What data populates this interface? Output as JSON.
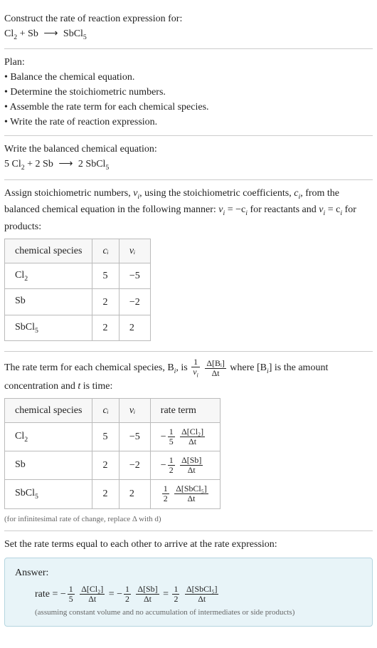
{
  "prompt": {
    "intro": "Construct the rate of reaction expression for:",
    "equation_lhs1": "Cl",
    "equation_lhs1_sub": "2",
    "equation_plus1": " + Sb ",
    "equation_arrow": "⟶",
    "equation_rhs": " SbCl",
    "equation_rhs_sub": "5"
  },
  "plan": {
    "title": "Plan:",
    "items": [
      "Balance the chemical equation.",
      "Determine the stoichiometric numbers.",
      "Assemble the rate term for each chemical species.",
      "Write the rate of reaction expression."
    ]
  },
  "balanced": {
    "intro": "Write the balanced chemical equation:",
    "c1": "5 Cl",
    "c1_sub": "2",
    "plus": " + 2 Sb ",
    "arrow": "⟶",
    "rhs": " 2 SbCl",
    "rhs_sub": "5"
  },
  "stoich_intro": {
    "part1": "Assign stoichiometric numbers, ",
    "nu": "ν",
    "nui_sub": "i",
    "part2": ", using the stoichiometric coefficients, ",
    "c": "c",
    "ci_sub": "i",
    "part3": ", from the balanced chemical equation in the following manner: ",
    "rel1a": "ν",
    "rel1b": "i",
    "rel1c": " = −c",
    "rel1d": "i",
    "part4": " for reactants and ",
    "rel2a": "ν",
    "rel2b": "i",
    "rel2c": " = c",
    "rel2d": "i",
    "part5": " for products:"
  },
  "table1": {
    "headers": [
      "chemical species",
      "cᵢ",
      "νᵢ"
    ],
    "rows": [
      {
        "name": "Cl",
        "sub": "2",
        "ci": "5",
        "vi": "−5"
      },
      {
        "name": "Sb",
        "sub": "",
        "ci": "2",
        "vi": "−2"
      },
      {
        "name": "SbCl",
        "sub": "5",
        "ci": "2",
        "vi": "2"
      }
    ]
  },
  "rate_intro": {
    "part1": "The rate term for each chemical species, B",
    "bi_sub": "i",
    "part2": ", is ",
    "f1_num": "1",
    "f1_den_a": "ν",
    "f1_den_b": "i",
    "f2_num": "Δ[Bᵢ]",
    "f2_den": "Δt",
    "part3": " where [B",
    "bi2_sub": "i",
    "part4": "] is the amount concentration and ",
    "t": "t",
    "part5": " is time:"
  },
  "table2": {
    "headers": [
      "chemical species",
      "cᵢ",
      "νᵢ",
      "rate term"
    ],
    "rows": [
      {
        "name": "Cl",
        "sub": "2",
        "ci": "5",
        "vi": "−5",
        "sign": "−",
        "fnum": "1",
        "fden": "5",
        "dnum": "Δ[Cl₂]",
        "dden": "Δt"
      },
      {
        "name": "Sb",
        "sub": "",
        "ci": "2",
        "vi": "−2",
        "sign": "−",
        "fnum": "1",
        "fden": "2",
        "dnum": "Δ[Sb]",
        "dden": "Δt"
      },
      {
        "name": "SbCl",
        "sub": "5",
        "ci": "2",
        "vi": "2",
        "sign": "",
        "fnum": "1",
        "fden": "2",
        "dnum": "Δ[SbCl₅]",
        "dden": "Δt"
      }
    ]
  },
  "note1": "(for infinitesimal rate of change, replace Δ with d)",
  "final_intro": "Set the rate terms equal to each other to arrive at the rate expression:",
  "answer": {
    "label": "Answer:",
    "rate_eq": "rate = ",
    "s1_sign": "−",
    "s1_fnum": "1",
    "s1_fden": "5",
    "s1_dnum": "Δ[Cl₂]",
    "s1_dden": "Δt",
    "eq1": " = ",
    "s2_sign": "−",
    "s2_fnum": "1",
    "s2_fden": "2",
    "s2_dnum": "Δ[Sb]",
    "s2_dden": "Δt",
    "eq2": " = ",
    "s3_sign": "",
    "s3_fnum": "1",
    "s3_fden": "2",
    "s3_dnum": "Δ[SbCl₅]",
    "s3_dden": "Δt",
    "note": "(assuming constant volume and no accumulation of intermediates or side products)"
  },
  "chart_data": {
    "type": "table",
    "tables": [
      {
        "title": "Stoichiometric numbers",
        "columns": [
          "chemical species",
          "c_i",
          "ν_i"
        ],
        "rows": [
          [
            "Cl2",
            5,
            -5
          ],
          [
            "Sb",
            2,
            -2
          ],
          [
            "SbCl5",
            2,
            2
          ]
        ]
      },
      {
        "title": "Rate terms",
        "columns": [
          "chemical species",
          "c_i",
          "ν_i",
          "rate term"
        ],
        "rows": [
          [
            "Cl2",
            5,
            -5,
            "-(1/5) Δ[Cl2]/Δt"
          ],
          [
            "Sb",
            2,
            -2,
            "-(1/2) Δ[Sb]/Δt"
          ],
          [
            "SbCl5",
            2,
            2,
            "(1/2) Δ[SbCl5]/Δt"
          ]
        ]
      }
    ]
  }
}
